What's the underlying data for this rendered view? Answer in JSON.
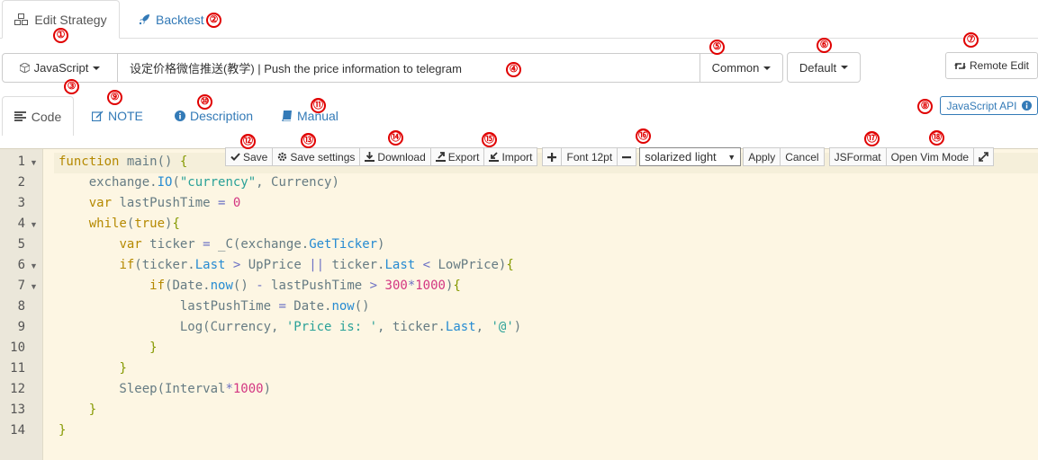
{
  "top_tabs": {
    "edit_strategy": "Edit Strategy",
    "backtest": "Backtest"
  },
  "strategy_bar": {
    "language": "JavaScript",
    "strategy_name": "设定价格微信推送(教学) | Push the price information to telegram",
    "category": "Common",
    "template": "Default",
    "remote_edit": "Remote Edit"
  },
  "sub_tabs": {
    "code": "Code",
    "note": "NOTE",
    "description": "Description",
    "manual": "Manual"
  },
  "api_button": "JavaScript API",
  "toolbar": {
    "save": "Save",
    "save_settings": "Save settings",
    "download": "Download",
    "export": "Export",
    "import": "Import",
    "font": "Font 12pt",
    "theme": "solarized light",
    "apply": "Apply",
    "cancel": "Cancel",
    "jsformat": "JSFormat",
    "vim_mode": "Open Vim Mode"
  },
  "annotations": [
    "①",
    "②",
    "③",
    "④",
    "⑤",
    "⑥",
    "⑦",
    "⑧",
    "⑨",
    "⑩",
    "⑪",
    "⑫",
    "⑬",
    "⑭",
    "⑮",
    "⑯",
    "⑰",
    "⑱"
  ],
  "line_numbers": [
    "1",
    "2",
    "3",
    "4",
    "5",
    "6",
    "7",
    "8",
    "9",
    "10",
    "11",
    "12",
    "13",
    "14"
  ],
  "code_lines": [
    "function main() {",
    "    exchange.IO(\"currency\", Currency)",
    "    var lastPushTime = 0",
    "    while(true){",
    "        var ticker = _C(exchange.GetTicker)",
    "        if(ticker.Last > UpPrice || ticker.Last < LowPrice){",
    "            if(Date.now() - lastPushTime > 300*1000){",
    "                lastPushTime = Date.now()",
    "                Log(Currency, 'Price is: ', ticker.Last, '@')",
    "            }",
    "        }",
    "        Sleep(Interval*1000)",
    "    }",
    "}"
  ],
  "icons": {
    "edit_strategy": "cubes-icon",
    "backtest": "rocket-icon",
    "language": "code-icon",
    "remote_edit": "retweet-icon",
    "code": "align-left-icon",
    "note": "edit-icon",
    "description": "info-circle-icon",
    "manual": "book-icon",
    "api": "info-circle-icon",
    "save": "check-icon",
    "save_settings": "gear-icon",
    "download": "download-icon",
    "export": "export-icon",
    "import": "import-icon",
    "font_plus": "plus-icon",
    "font_minus": "minus-icon",
    "fullscreen": "expand-icon"
  },
  "colors": {
    "annotation": "#e00000",
    "link": "#337ab7",
    "editor_bg": "#fdf6e3",
    "gutter_bg": "#ebe7da"
  }
}
